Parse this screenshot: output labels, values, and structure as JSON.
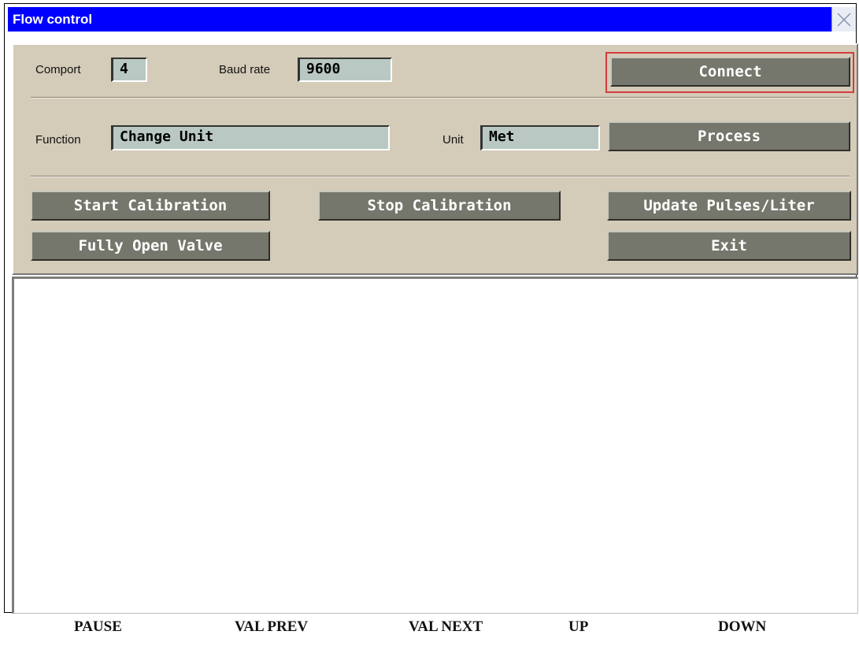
{
  "window": {
    "title": "Flow control"
  },
  "connection": {
    "comport_label": "Comport",
    "comport_value": "4",
    "baud_label": "Baud rate",
    "baud_value": "9600",
    "connect_button": "Connect"
  },
  "function_row": {
    "function_label": "Function",
    "function_value": "Change Unit",
    "unit_label": "Unit",
    "unit_value": "Met",
    "process_button": "Process"
  },
  "actions": {
    "start_calibration": "Start Calibration",
    "stop_calibration": "Stop Calibration",
    "update_pulses": "Update Pulses/Liter",
    "fully_open_valve": "Fully Open Valve",
    "exit": "Exit"
  },
  "bottom_bar": {
    "pause": "PAUSE",
    "val_prev": "VAL PREV",
    "val_next": "VAL NEXT",
    "up": "UP",
    "down": "DOWN"
  },
  "colors": {
    "titlebar": "#0000ff",
    "panel": "#d4cbb8",
    "button": "#76776c",
    "field": "#b9c8c2",
    "focus_ring": "#d23c3c"
  }
}
